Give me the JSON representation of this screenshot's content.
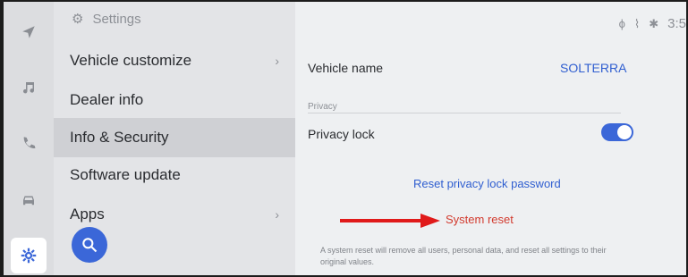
{
  "sidebar": {
    "icons": [
      {
        "name": "navigation-icon",
        "glyph": "➤",
        "active": false
      },
      {
        "name": "music-icon",
        "glyph": "♫",
        "active": false
      },
      {
        "name": "phone-icon",
        "glyph": "✆",
        "active": false
      },
      {
        "name": "car-icon",
        "glyph": "⛟",
        "active": false
      },
      {
        "name": "gear-icon",
        "glyph": "⚙",
        "active": true
      }
    ]
  },
  "menu": {
    "header": "Settings",
    "items": [
      {
        "label": "Vehicle customize",
        "chevron": true,
        "active": false
      },
      {
        "label": "Dealer info",
        "chevron": false,
        "active": false
      },
      {
        "label": "Info & Security",
        "chevron": false,
        "active": true
      },
      {
        "label": "Software update",
        "chevron": false,
        "active": false
      },
      {
        "label": "Apps",
        "chevron": true,
        "active": false
      }
    ],
    "search_icon": "search-icon"
  },
  "status_bar": {
    "time": "3:5"
  },
  "content": {
    "vehicle_name_label": "Vehicle name",
    "vehicle_name_value": "SOLTERRA",
    "privacy_section": "Privacy",
    "privacy_lock_label": "Privacy lock",
    "privacy_lock_on": true,
    "reset_password_link": "Reset privacy lock password",
    "system_reset_link": "System reset",
    "system_reset_note": "A system reset will remove all users, personal data, and reset all settings to their original values."
  },
  "colors": {
    "accent": "#3b67d8",
    "danger": "#d23a2e",
    "arrow": "#e01a1a"
  }
}
